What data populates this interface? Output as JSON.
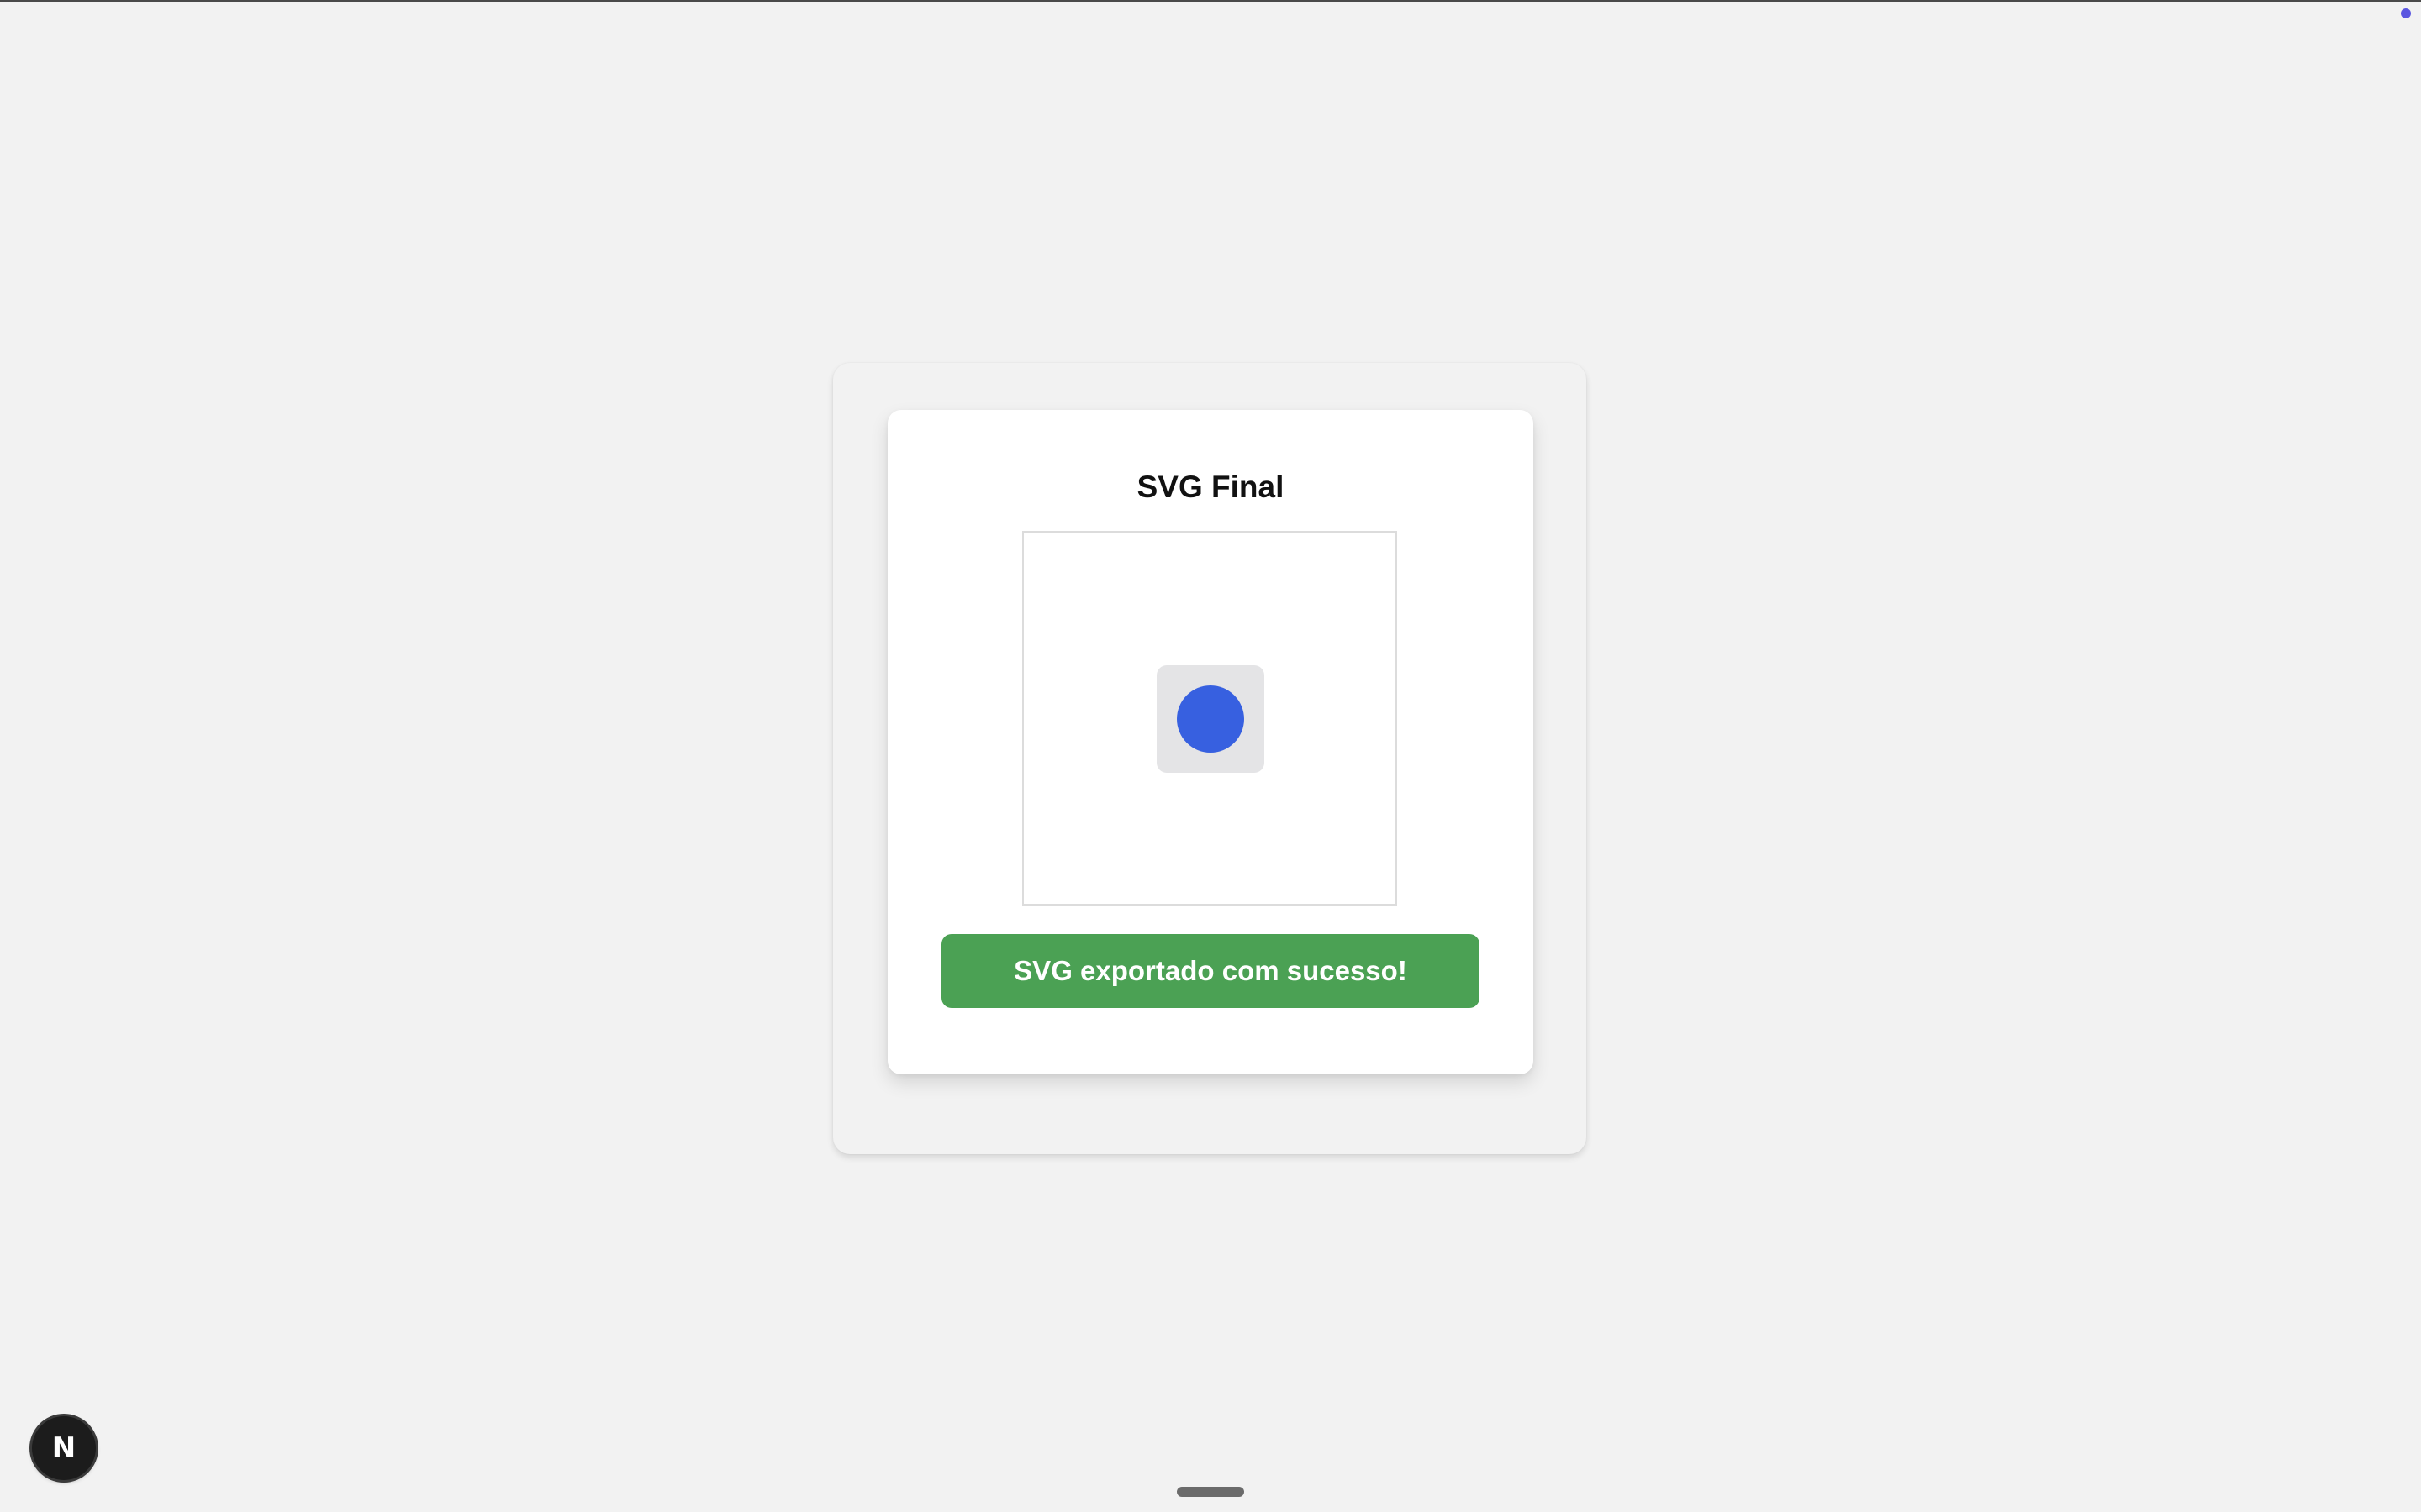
{
  "card": {
    "title": "SVG Final"
  },
  "preview": {
    "shape_fill": "#3760e0",
    "backdrop_fill": "#e4e4e6"
  },
  "status": {
    "message": "SVG exportado com sucesso!",
    "color": "#4ba154"
  },
  "dev_badge": {
    "label": "N",
    "icon": "nextjs-logo-icon"
  }
}
